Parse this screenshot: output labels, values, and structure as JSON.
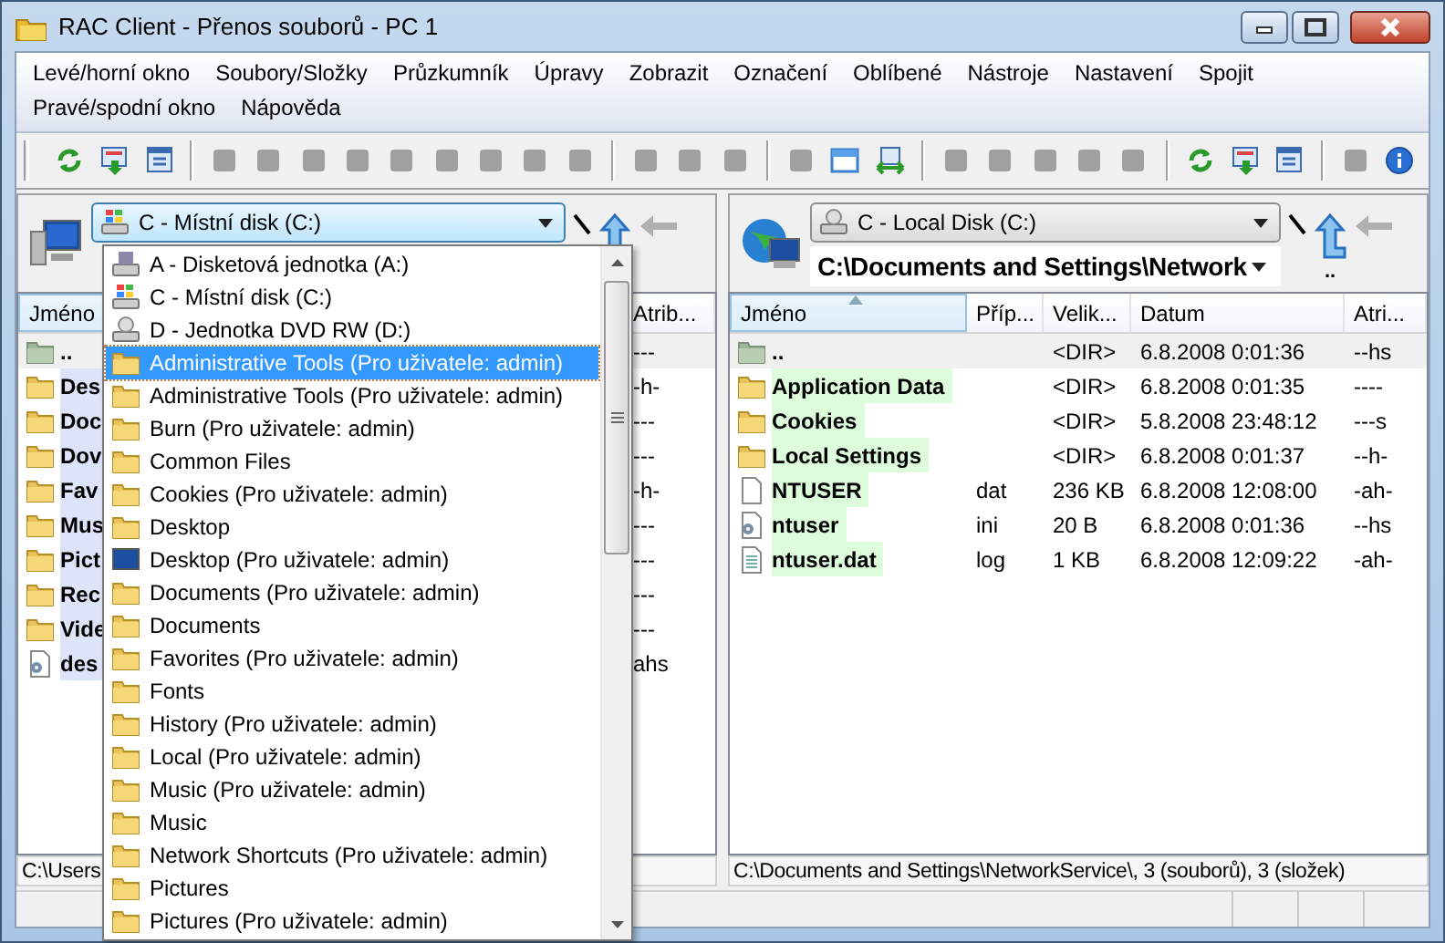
{
  "window": {
    "title": "RAC Client - Přenos souborů - PC 1"
  },
  "menu": [
    "Levé/horní okno",
    "Soubory/Složky",
    "Průzkumník",
    "Úpravy",
    "Zobrazit",
    "Označení",
    "Oblíbené",
    "Nástroje",
    "Nastavení",
    "Spojit",
    "Pravé/spodní okno",
    "Nápověda"
  ],
  "toolbar": [
    {
      "kind": "button",
      "disabled": false
    },
    {
      "kind": "button",
      "disabled": false
    },
    {
      "kind": "button",
      "disabled": false
    },
    {
      "kind": "separator"
    },
    {
      "kind": "button",
      "disabled": true
    },
    {
      "kind": "button",
      "disabled": true
    },
    {
      "kind": "button",
      "disabled": true
    },
    {
      "kind": "button",
      "disabled": true
    },
    {
      "kind": "button",
      "disabled": true
    },
    {
      "kind": "button",
      "disabled": true
    },
    {
      "kind": "button",
      "disabled": true
    },
    {
      "kind": "button",
      "disabled": true
    },
    {
      "kind": "button",
      "disabled": true
    },
    {
      "kind": "separator"
    },
    {
      "kind": "button",
      "disabled": true
    },
    {
      "kind": "button",
      "disabled": true
    },
    {
      "kind": "button",
      "disabled": true
    },
    {
      "kind": "separator"
    },
    {
      "kind": "button",
      "disabled": true
    },
    {
      "kind": "button",
      "disabled": false
    },
    {
      "kind": "button",
      "disabled": false
    },
    {
      "kind": "separator"
    },
    {
      "kind": "button",
      "disabled": true
    },
    {
      "kind": "button",
      "disabled": true
    },
    {
      "kind": "button",
      "disabled": true
    },
    {
      "kind": "button",
      "disabled": true
    },
    {
      "kind": "button",
      "disabled": true
    },
    {
      "kind": "separator"
    },
    {
      "kind": "button",
      "disabled": false
    },
    {
      "kind": "button",
      "disabled": false
    },
    {
      "kind": "button",
      "disabled": false
    },
    {
      "kind": "separator"
    },
    {
      "kind": "button",
      "disabled": true
    },
    {
      "kind": "button",
      "disabled": false
    }
  ],
  "left_panel": {
    "drive": {
      "label": "C - Místní disk (C:)",
      "expanded": true
    },
    "columns": [
      "Jméno",
      "Atrib..."
    ],
    "rows": [
      {
        "kind": "up",
        "name": "..",
        "attr": "---",
        "focused": true,
        "marked": false
      },
      {
        "kind": "folder",
        "name": "Des",
        "attr": "-h-",
        "focused": false,
        "marked": true
      },
      {
        "kind": "folder",
        "name": "Doc",
        "attr": "---",
        "focused": false,
        "marked": true
      },
      {
        "kind": "folder",
        "name": "Dov",
        "attr": "---",
        "focused": false,
        "marked": true
      },
      {
        "kind": "folder",
        "name": "Fav",
        "attr": "-h-",
        "focused": false,
        "marked": true
      },
      {
        "kind": "folder",
        "name": "Mus",
        "attr": "---",
        "focused": false,
        "marked": true
      },
      {
        "kind": "folder",
        "name": "Pict",
        "attr": "---",
        "focused": false,
        "marked": true
      },
      {
        "kind": "folder",
        "name": "Rec",
        "attr": "---",
        "focused": false,
        "marked": true
      },
      {
        "kind": "folder",
        "name": "Vide",
        "attr": "---",
        "focused": false,
        "marked": true
      },
      {
        "kind": "config",
        "name": "des",
        "attr": "ahs",
        "focused": false,
        "marked": true
      }
    ],
    "status": "C:\\Users",
    "dropdown": [
      {
        "kind": "floppy",
        "label": "A - Disketová jednotka (A:)",
        "selected": false
      },
      {
        "kind": "disk",
        "label": "C - Místní disk (C:)",
        "selected": false
      },
      {
        "kind": "dvd",
        "label": "D - Jednotka DVD RW (D:)",
        "selected": false
      },
      {
        "kind": "folder",
        "label": "Administrative Tools (Pro uživatele: admin)",
        "selected": true
      },
      {
        "kind": "folder",
        "label": "Administrative Tools (Pro uživatele: admin)",
        "selected": false
      },
      {
        "kind": "folder",
        "label": "Burn (Pro uživatele: admin)",
        "selected": false
      },
      {
        "kind": "folder",
        "label": "Common Files",
        "selected": false
      },
      {
        "kind": "folder",
        "label": "Cookies (Pro uživatele: admin)",
        "selected": false
      },
      {
        "kind": "folder",
        "label": "Desktop",
        "selected": false
      },
      {
        "kind": "screen",
        "label": "Desktop (Pro uživatele: admin)",
        "selected": false
      },
      {
        "kind": "folder",
        "label": "Documents (Pro uživatele: admin)",
        "selected": false
      },
      {
        "kind": "folder",
        "label": "Documents",
        "selected": false
      },
      {
        "kind": "folder",
        "label": "Favorites (Pro uživatele: admin)",
        "selected": false
      },
      {
        "kind": "folder",
        "label": "Fonts",
        "selected": false
      },
      {
        "kind": "folder",
        "label": "History (Pro uživatele: admin)",
        "selected": false
      },
      {
        "kind": "folder",
        "label": "Local (Pro uživatele: admin)",
        "selected": false
      },
      {
        "kind": "folder",
        "label": "Music (Pro uživatele: admin)",
        "selected": false
      },
      {
        "kind": "folder",
        "label": "Music",
        "selected": false
      },
      {
        "kind": "folder",
        "label": "Network Shortcuts (Pro uživatele: admin)",
        "selected": false
      },
      {
        "kind": "folder",
        "label": "Pictures",
        "selected": false
      },
      {
        "kind": "folder",
        "label": "Pictures (Pro uživatele: admin)",
        "selected": false
      }
    ]
  },
  "right_panel": {
    "drive": {
      "label": "C - Local Disk (C:)",
      "expanded": false
    },
    "path": "C:\\Documents and Settings\\Network",
    "up_label": "..",
    "columns": [
      "Jméno",
      "Příp...",
      "Velik...",
      "Datum",
      "Atri..."
    ],
    "rows": [
      {
        "kind": "up",
        "name": "..",
        "ext": "",
        "size": "<DIR>",
        "date": "6.8.2008 0:01:36",
        "attr": "--hs",
        "focused": true,
        "marked": false
      },
      {
        "kind": "folder",
        "name": "Application Data",
        "ext": "",
        "size": "<DIR>",
        "date": "6.8.2008 0:01:35",
        "attr": "----",
        "focused": false,
        "marked": true
      },
      {
        "kind": "folder",
        "name": "Cookies",
        "ext": "",
        "size": "<DIR>",
        "date": "5.8.2008 23:48:12",
        "attr": "---s",
        "focused": false,
        "marked": true
      },
      {
        "kind": "folder",
        "name": "Local Settings",
        "ext": "",
        "size": "<DIR>",
        "date": "6.8.2008 0:01:37",
        "attr": "--h-",
        "focused": false,
        "marked": true
      },
      {
        "kind": "file",
        "name": "NTUSER",
        "ext": "dat",
        "size": "236 KB",
        "date": "6.8.2008 12:08:00",
        "attr": "-ah-",
        "focused": false,
        "marked": true
      },
      {
        "kind": "config",
        "name": "ntuser",
        "ext": "ini",
        "size": "20 B",
        "date": "6.8.2008 0:01:36",
        "attr": "--hs",
        "focused": false,
        "marked": true
      },
      {
        "kind": "text",
        "name": "ntuser.dat",
        "ext": "log",
        "size": "1 KB",
        "date": "6.8.2008 12:09:22",
        "attr": "-ah-",
        "focused": false,
        "marked": true
      }
    ],
    "status": "C:\\Documents and Settings\\NetworkService\\, 3 (souborů), 3 (složek)"
  }
}
